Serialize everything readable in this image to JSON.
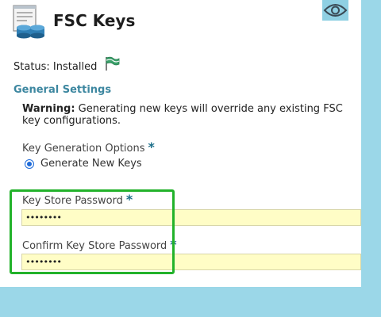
{
  "header": {
    "title": "FSC Keys",
    "icon": "database-form-icon",
    "view_icon": "eye-icon"
  },
  "status": {
    "text": "Status: Installed",
    "icon": "flag-icon"
  },
  "section": {
    "title": "General Settings"
  },
  "warning": {
    "label": "Warning:",
    "text": " Generating new keys will override any existing FSC key configurations."
  },
  "key_generation": {
    "label": "Key Generation Options",
    "required_mark": "*",
    "option_label": "Generate New Keys",
    "selected": true
  },
  "key_store_password": {
    "label": "Key Store Password",
    "required_mark": "*",
    "value": "••••••••"
  },
  "confirm_password": {
    "label": "Confirm Key Store Password",
    "required_mark": "*",
    "value": "••••••••"
  },
  "colors": {
    "background": "#9bd7e8",
    "accent": "#3d87a0",
    "field_fill": "#fffdc6",
    "highlight": "#22b22a"
  }
}
